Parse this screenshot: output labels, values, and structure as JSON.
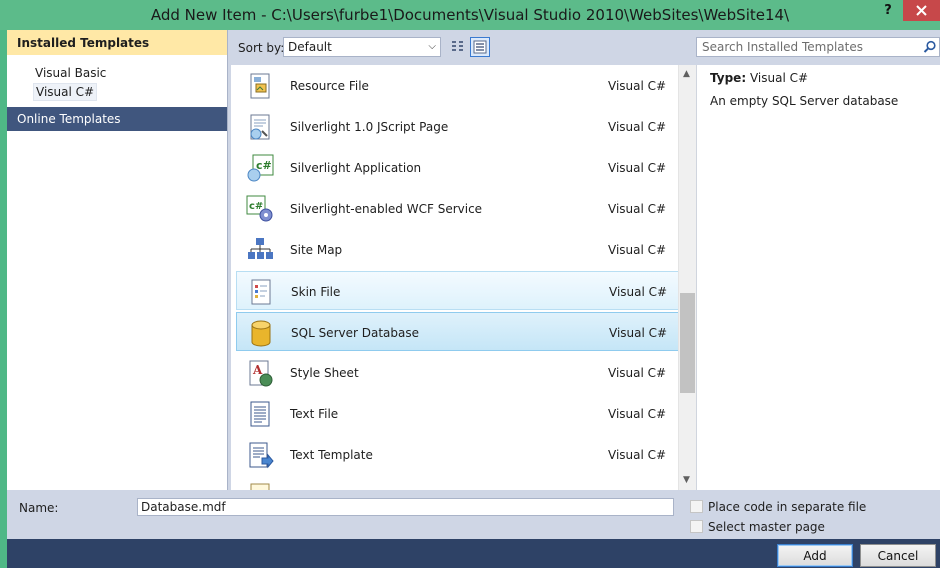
{
  "window": {
    "title": "Add New Item - C:\\Users\\furbe1\\Documents\\Visual Studio 2010\\WebSites\\WebSite14\\",
    "help": "?"
  },
  "sidebar": {
    "installed_header": "Installed Templates",
    "items": [
      {
        "label": "Visual Basic"
      },
      {
        "label": "Visual C#"
      }
    ],
    "online": "Online Templates"
  },
  "toolbar": {
    "sort_label": "Sort by:",
    "sort_value": "Default"
  },
  "search": {
    "placeholder": "Search Installed Templates"
  },
  "templates": [
    {
      "name": "Resource File",
      "lang": "Visual C#",
      "icon": "resource-file-icon"
    },
    {
      "name": "Silverlight 1.0 JScript Page",
      "lang": "Visual C#",
      "icon": "silverlight-jscript-icon"
    },
    {
      "name": "Silverlight Application",
      "lang": "Visual C#",
      "icon": "silverlight-app-icon"
    },
    {
      "name": "Silverlight-enabled WCF Service",
      "lang": "Visual C#",
      "icon": "wcf-service-icon"
    },
    {
      "name": "Site Map",
      "lang": "Visual C#",
      "icon": "site-map-icon"
    },
    {
      "name": "Skin File",
      "lang": "Visual C#",
      "icon": "skin-file-icon",
      "state": "hover"
    },
    {
      "name": "SQL Server Database",
      "lang": "Visual C#",
      "icon": "database-icon",
      "state": "selected"
    },
    {
      "name": "Style Sheet",
      "lang": "Visual C#",
      "icon": "style-sheet-icon"
    },
    {
      "name": "Text File",
      "lang": "Visual C#",
      "icon": "text-file-icon"
    },
    {
      "name": "Text Template",
      "lang": "Visual C#",
      "icon": "text-template-icon"
    }
  ],
  "details": {
    "type_label": "Type:",
    "type_value": "Visual C#",
    "description": "An empty SQL Server database"
  },
  "form": {
    "name_label": "Name:",
    "name_value": "Database.mdf",
    "separate_file": "Place code in separate file",
    "master_page": "Select master page"
  },
  "buttons": {
    "add": "Add",
    "cancel": "Cancel"
  },
  "colors": {
    "accent_title": "#5cbb8a",
    "selection": "#ffe8a6",
    "online_bg": "#40567e",
    "footer": "#2e4266"
  }
}
